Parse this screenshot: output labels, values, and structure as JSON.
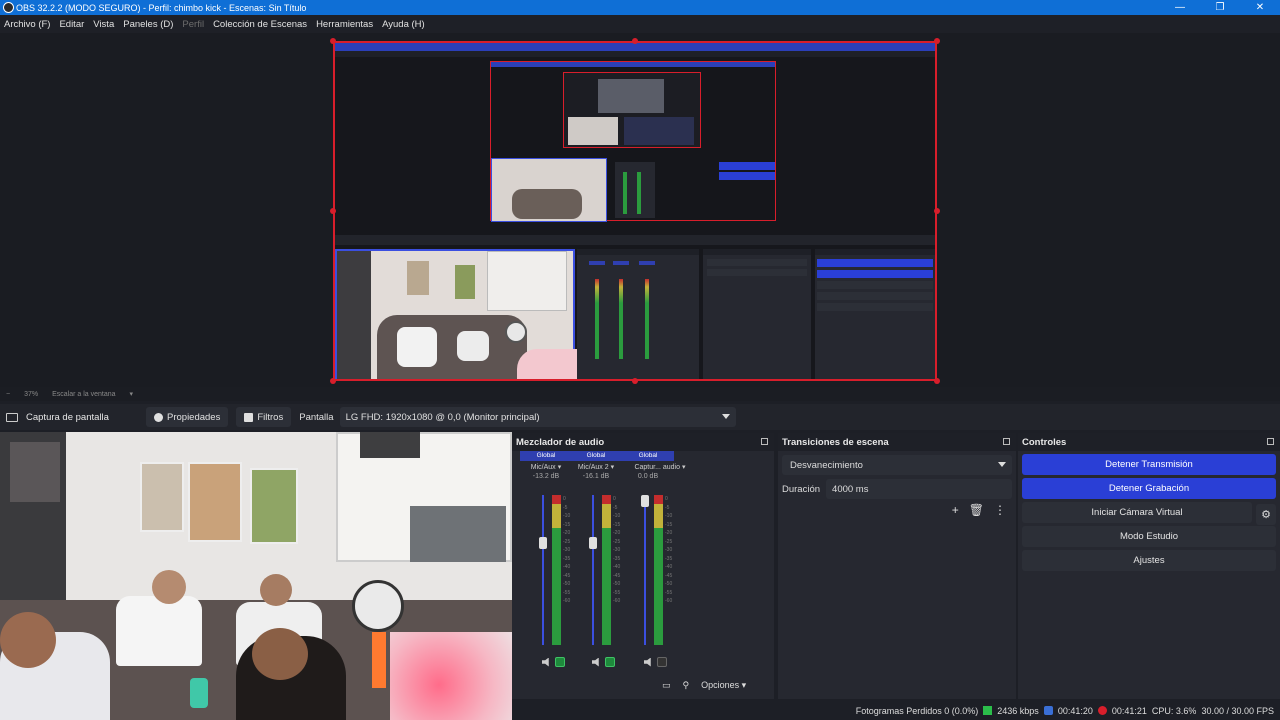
{
  "window": {
    "title": "OBS 32.2.2 (MODO SEGURO) - Perfil: chimbo kick - Escenas: Sin Título",
    "minimize": "—",
    "maximize": "❐",
    "close": "✕"
  },
  "menu": [
    {
      "label": "Archivo (F)",
      "enabled": true
    },
    {
      "label": "Editar",
      "enabled": true
    },
    {
      "label": "Vista",
      "enabled": true
    },
    {
      "label": "Paneles (D)",
      "enabled": true
    },
    {
      "label": "Perfil",
      "enabled": false
    },
    {
      "label": "Colección de Escenas",
      "enabled": true
    },
    {
      "label": "Herramientas",
      "enabled": true
    },
    {
      "label": "Ayuda (H)",
      "enabled": true
    }
  ],
  "zoom": {
    "value": "37%",
    "mode": "Escalar a la ventana"
  },
  "source_toolbar": {
    "source_name": "Captura de pantalla",
    "properties": "Propiedades",
    "filters": "Filtros",
    "display_label": "Pantalla",
    "display_value": "LG FHD: 1920x1080 @ 0,0 (Monitor principal)"
  },
  "mixer": {
    "title": "Mezclador de audio",
    "channels": [
      {
        "tag": "Global",
        "name": "Mic/Aux",
        "db": "-13.2 dB",
        "fader": 0.68
      },
      {
        "tag": "Global",
        "name": "Mic/Aux 2",
        "db": "-16.1 dB",
        "fader": 0.68
      },
      {
        "tag": "Global",
        "name": "Captur... audio",
        "db": "0.0 dB",
        "fader": 0.96
      }
    ],
    "ticks": [
      "0",
      "-5",
      "-10",
      "-15",
      "-20",
      "-25",
      "-30",
      "-35",
      "-40",
      "-45",
      "-50",
      "-55",
      "-60"
    ],
    "options": "Opciones"
  },
  "transitions": {
    "title": "Transiciones de escena",
    "selected": "Desvanecimiento",
    "duration_label": "Duración",
    "duration_value": "4000 ms"
  },
  "controls": {
    "title": "Controles",
    "stop_stream": "Detener Transmisión",
    "stop_record": "Detener Grabación",
    "virtual_cam": "Iniciar Cámara Virtual",
    "studio_mode": "Modo Estudio",
    "settings": "Ajustes"
  },
  "status": {
    "dropped": "Fotogramas Perdidos 0 (0.0%)",
    "bitrate": "2436 kbps",
    "stream_time": "00:41:20",
    "rec_time": "00:41:21",
    "cpu": "CPU: 3.6%",
    "fps": "30.00 / 30.00 FPS"
  },
  "colors": {
    "accent_blue": "#2a3fd6",
    "selection_red": "#d81e2b",
    "titlebar": "#0f6fd6"
  }
}
